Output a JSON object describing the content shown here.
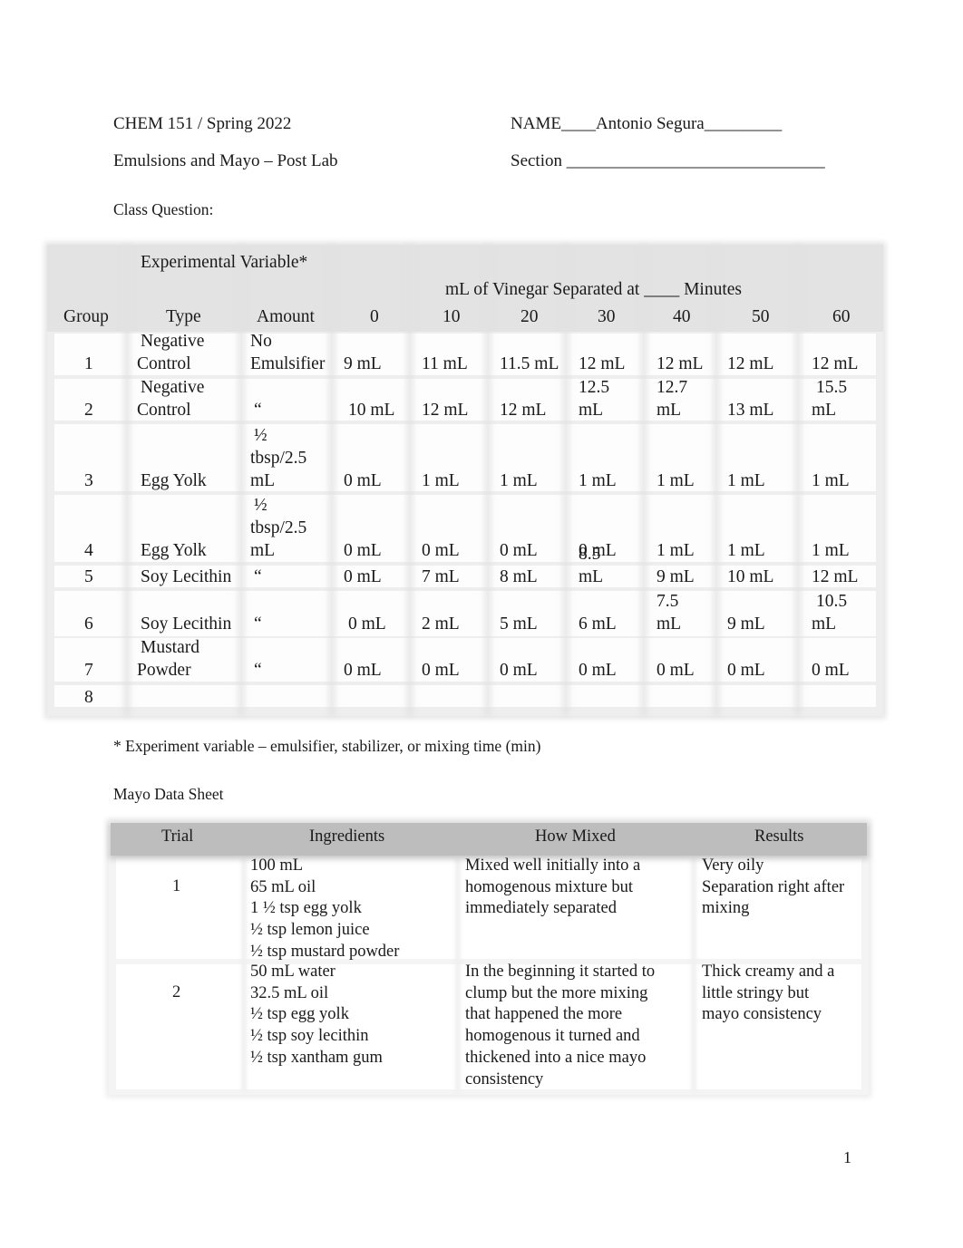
{
  "header": {
    "course": "CHEM 151 / Spring 2022",
    "title": "Emulsions and Mayo – Post Lab",
    "name_label": "NAME____Antonio Segura_________",
    "section_label": "Section ______________________________",
    "class_question": "Class Question:"
  },
  "vinegar_table": {
    "group_header": "Experimental Variable*",
    "minutes_header": "mL of Vinegar Separated at ____ Minutes",
    "columns": [
      "Group",
      "Type",
      "Amount",
      "0",
      "10",
      "20",
      "30",
      "40",
      "50",
      "60"
    ],
    "rows": [
      {
        "group": "1",
        "type": [
          "Negative",
          "Control"
        ],
        "amount": [
          "No",
          "Emulsifier"
        ],
        "values": [
          "9 mL",
          "11 mL",
          "11.5 mL",
          "12 mL",
          "12 mL",
          "12 mL",
          "12 mL"
        ]
      },
      {
        "group": "2",
        "type": [
          "Negative",
          "Control"
        ],
        "amount": [
          "“"
        ],
        "values": [
          "10 mL",
          "12 mL",
          "12 mL",
          "12.5 mL",
          "12.7 mL",
          "13 mL",
          "15.5 mL"
        ]
      },
      {
        "group": "3",
        "type": [
          "Egg Yolk"
        ],
        "amount": [
          "½",
          "tbsp/2.5",
          "mL"
        ],
        "values": [
          "0 mL",
          "1 mL",
          "1 mL",
          "1 mL",
          "1 mL",
          "1 mL",
          "1 mL"
        ]
      },
      {
        "group": "4",
        "type": [
          "Egg Yolk"
        ],
        "amount": [
          "½",
          "tbsp/2.5",
          "mL"
        ],
        "values": [
          "0 mL",
          "0 mL",
          "0 mL",
          "0 mL",
          "1 mL",
          "1 mL",
          "1 mL"
        ]
      },
      {
        "group": "5",
        "type": [
          "Soy Lecithin"
        ],
        "amount": [
          "“"
        ],
        "values": [
          "0 mL",
          "7 mL",
          "8 mL",
          "8.5 mL",
          "9 mL",
          "10 mL",
          "12 mL"
        ]
      },
      {
        "group": "6",
        "type": [
          "Soy Lecithin"
        ],
        "amount": [
          "“"
        ],
        "values": [
          "0 mL",
          "2 mL",
          "5 mL",
          "6 mL",
          "7.5 mL",
          "9 mL",
          "10.5 mL"
        ]
      },
      {
        "group": "7",
        "type": [
          "Mustard",
          "Powder"
        ],
        "amount": [
          "“"
        ],
        "values": [
          "0 mL",
          "0 mL",
          "0 mL",
          "0 mL",
          "0 mL",
          "0 mL",
          "0 mL"
        ]
      },
      {
        "group": "8",
        "type": [],
        "amount": [],
        "values": [
          "",
          "",
          "",
          "",
          "",
          "",
          ""
        ]
      }
    ],
    "footnote": "* Experiment variable  – emulsifier, stabilizer, or mixing time (min)"
  },
  "mayo_sheet": {
    "title": "Mayo Data Sheet",
    "columns": [
      "Trial",
      "Ingredients",
      "How Mixed",
      "Results"
    ],
    "rows": [
      {
        "trial": "1",
        "ingredients": [
          "100 mL",
          "65 mL oil",
          "1 ½ tsp egg yolk",
          "½ tsp lemon juice",
          "½ tsp mustard powder"
        ],
        "how_mixed": [
          "Mixed well initially into a",
          "homogenous mixture but",
          "immediately separated"
        ],
        "results": [
          "Very oily",
          "Separation right after",
          "mixing"
        ]
      },
      {
        "trial": "2",
        "ingredients": [
          "50 mL water",
          "32.5 mL oil",
          "½ tsp egg yolk",
          "½ tsp soy lecithin",
          "½ tsp xantham gum"
        ],
        "how_mixed": [
          "In the beginning it started to",
          "clump but the more mixing",
          "that happened the more",
          "homogenous it turned and",
          "thickened into a nice mayo",
          "consistency"
        ],
        "results": [
          "Thick creamy and a",
          "little stringy but",
          "mayo consistency"
        ]
      }
    ]
  },
  "footer": {
    "page_number": "1"
  }
}
